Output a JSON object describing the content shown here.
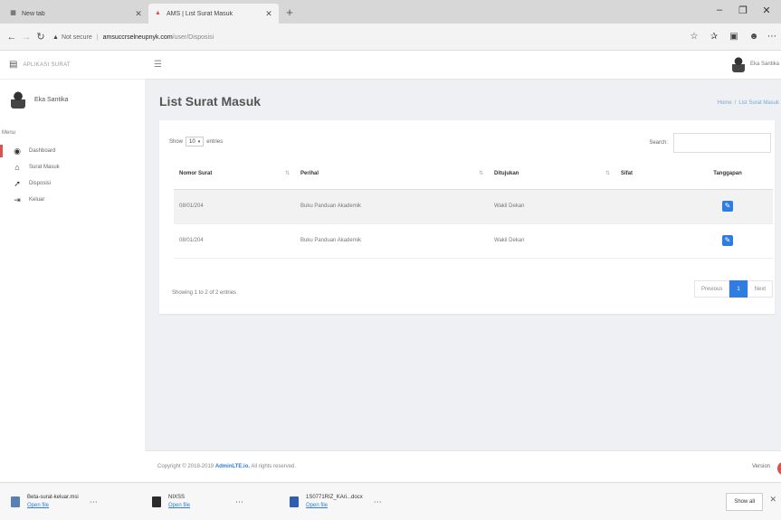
{
  "browser": {
    "tabs": [
      {
        "title": "New tab",
        "icon": "new-tab-page-icon"
      },
      {
        "title": "AMS | List Surat Masuk",
        "icon": "site-favicon"
      }
    ],
    "new_tab": "+",
    "window_controls": [
      "–",
      "❐",
      "✕"
    ],
    "nav": {
      "back": "←",
      "forward": "→",
      "reload": "↻"
    },
    "url": {
      "security_icon": "warning-icon",
      "security_label": "Not secure",
      "host": "amsuccrselneupnyk.com",
      "path": "/user/Disposisi"
    }
  },
  "app": {
    "brand_icon": "▤",
    "brand_text": "APLIKASI SURAT",
    "user_name": "Eka Santika",
    "menu_header": "Menu",
    "menu": [
      {
        "label": "Dashboard",
        "icon": "dashboard-icon",
        "glyph": "◉",
        "active": true
      },
      {
        "label": "Surat Masuk",
        "icon": "inbox-icon",
        "glyph": "⌂",
        "active": false
      },
      {
        "label": "Disposisi",
        "icon": "send-icon",
        "glyph": "➚",
        "active": false
      },
      {
        "label": "Keluar",
        "icon": "sign-out-icon",
        "glyph": "⇥",
        "active": false
      }
    ],
    "top_user": "Eka Santika"
  },
  "page": {
    "title": "List Surat Masuk",
    "breadcrumb": {
      "home": "Home",
      "sep": "/",
      "current": "List Surat Masuk"
    },
    "length": {
      "show": "Show",
      "value": "10",
      "entries": "entries"
    },
    "search_label": "Search:",
    "search_value": "",
    "table": {
      "headers": [
        "Nomor Surat",
        "Perihal",
        "Ditujukan",
        "Sifat",
        "Tanggapan"
      ],
      "rows": [
        {
          "nomor": "08/01/204",
          "perihal": "Buku Panduan Akademik",
          "ditujukan": "Wakil Dekan",
          "sifat": ""
        },
        {
          "nomor": "08/01/204",
          "perihal": "Buku Panduan Akademik",
          "ditujukan": "Wakil Dekan",
          "sifat": ""
        }
      ]
    },
    "info": "Showing 1 to 2 of 2 entries",
    "pagination": {
      "previous": "Previous",
      "current": "1",
      "next": "Next"
    }
  },
  "footer": {
    "copyright": "Copyright © 2018-2019",
    "brand": "AdminLTE.io.",
    "rights": "All rights reserved.",
    "version": "Version"
  },
  "downloads": [
    {
      "name": "Beta-surat-keluar.msi",
      "action": "Open file",
      "color": "#5a7fb5"
    },
    {
      "name": "NIXSS",
      "action": "Open file",
      "color": "#2b2b2b"
    },
    {
      "name": "1S0771RIZ_KAri...docx",
      "action": "Open file",
      "color": "#2f5fb0"
    }
  ],
  "show_all": "Show all"
}
